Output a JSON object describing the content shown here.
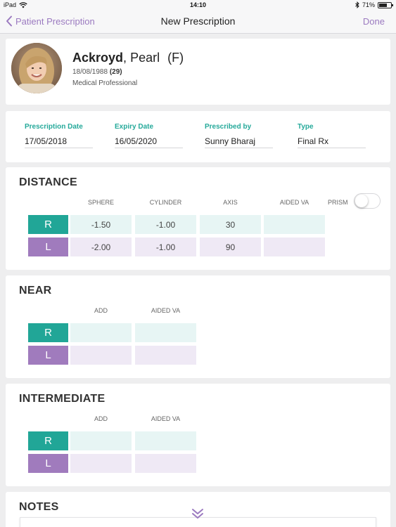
{
  "status_bar": {
    "device": "iPad",
    "time": "14:10",
    "battery": "71%",
    "battery_level": 0.71
  },
  "nav": {
    "back_label": "Patient Prescription",
    "title": "New Prescription",
    "done_label": "Done"
  },
  "patient": {
    "surname": "Ackroyd",
    "separator": ",",
    "first_name": "Pearl",
    "gender": "(F)",
    "dob": "18/08/1988",
    "age": "(29)",
    "occupation": "Medical Professional"
  },
  "prescription": {
    "fields": [
      {
        "label": "Prescription Date",
        "value": "17/05/2018"
      },
      {
        "label": "Expiry Date",
        "value": "16/05/2020"
      },
      {
        "label": "Prescribed by",
        "value": "Sunny Bharaj"
      },
      {
        "label": "Type",
        "value": "Final Rx"
      }
    ]
  },
  "distance": {
    "title": "DISTANCE",
    "columns": [
      "SPHERE",
      "CYLINDER",
      "AXIS",
      "AIDED VA"
    ],
    "prism_label": "PRISM",
    "prism_on": false,
    "rows": [
      {
        "label": "R",
        "values": [
          "-1.50",
          "-1.00",
          "30",
          ""
        ]
      },
      {
        "label": "L",
        "values": [
          "-2.00",
          "-1.00",
          "90",
          ""
        ]
      }
    ]
  },
  "near": {
    "title": "NEAR",
    "columns": [
      "ADD",
      "AIDED VA"
    ],
    "rows": [
      {
        "label": "R",
        "values": [
          "",
          ""
        ]
      },
      {
        "label": "L",
        "values": [
          "",
          ""
        ]
      }
    ]
  },
  "intermediate": {
    "title": "INTERMEDIATE",
    "columns": [
      "ADD",
      "AIDED VA"
    ],
    "rows": [
      {
        "label": "R",
        "values": [
          "",
          ""
        ]
      },
      {
        "label": "L",
        "values": [
          "",
          ""
        ]
      }
    ]
  },
  "notes": {
    "title": "NOTES"
  },
  "colors": {
    "accent": "#9b7ac0",
    "right_eye": "#21a697",
    "left_eye": "#a07bbd",
    "right_cell": "#e7f5f4",
    "left_cell": "#efe9f5"
  },
  "icons": {
    "back": "chevron-left-icon",
    "wifi": "wifi-icon",
    "bluetooth": "bluetooth-icon",
    "battery": "battery-icon",
    "scroll": "double-chevron-down-icon"
  }
}
